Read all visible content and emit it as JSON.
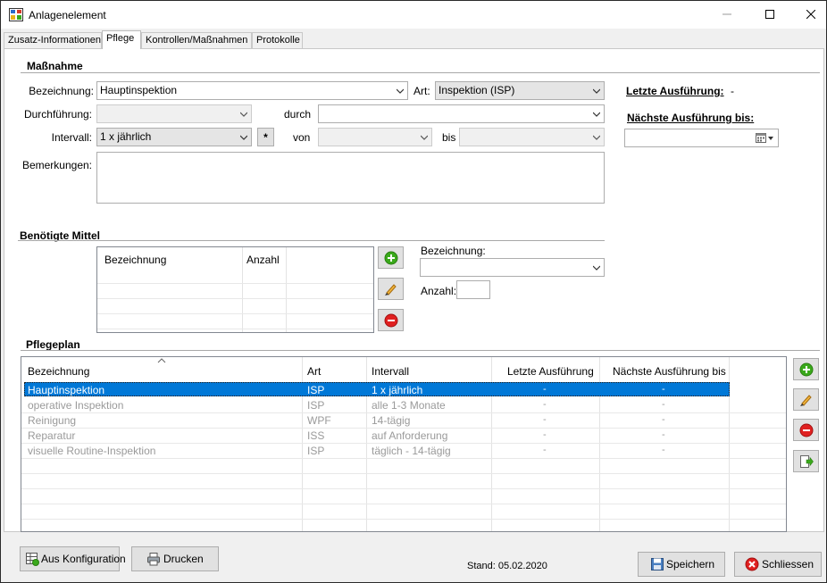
{
  "window": {
    "title": "Anlagenelement"
  },
  "tabs": [
    {
      "label": "Zusatz-Informationen",
      "active": false
    },
    {
      "label": "Pflege",
      "active": true
    },
    {
      "label": "Kontrollen/Maßnahmen",
      "active": false
    },
    {
      "label": "Protokolle",
      "active": false
    }
  ],
  "massnahme": {
    "section_title": "Maßnahme",
    "bezeichnung_label": "Bezeichnung:",
    "bezeichnung_value": "Hauptinspektion",
    "art_label": "Art:",
    "art_value": "Inspektion (ISP)",
    "durchfuehrung_label": "Durchführung:",
    "durchfuehrung_value": "",
    "durch_label": "durch",
    "durch_value": "",
    "intervall_label": "Intervall:",
    "intervall_value": "1 x jährlich",
    "star_button": "*",
    "von_label": "von",
    "von_value": "",
    "bis_label": "bis",
    "bis_value": "",
    "bemerkungen_label": "Bemerkungen:",
    "bemerkungen_value": ""
  },
  "ausfuehrung": {
    "letzte_label": "Letzte Ausführung:",
    "letzte_value": "-",
    "naechste_label": "Nächste Ausführung bis:",
    "naechste_value": ""
  },
  "mittel": {
    "section_title": "Benötigte Mittel",
    "columns": [
      "Bezeichnung",
      "Anzahl"
    ],
    "rows": [],
    "bezeichnung_label": "Bezeichnung:",
    "bezeichnung_value": "",
    "anzahl_label": "Anzahl:",
    "anzahl_value": ""
  },
  "pflegeplan": {
    "section_title": "Pflegeplan",
    "sort_indicator": "^",
    "columns": [
      "Bezeichnung",
      "Art",
      "Intervall",
      "Letzte Ausführung",
      "Nächste Ausführung bis"
    ],
    "rows": [
      {
        "bezeichnung": "Hauptinspektion",
        "art": "ISP",
        "intervall": "1 x jährlich",
        "letzte": "-",
        "naechste": "-",
        "selected": true
      },
      {
        "bezeichnung": "operative Inspektion",
        "art": "ISP",
        "intervall": "alle 1-3 Monate",
        "letzte": "-",
        "naechste": "-",
        "selected": false
      },
      {
        "bezeichnung": "Reinigung",
        "art": "WPF",
        "intervall": "14-tägig",
        "letzte": "-",
        "naechste": "-",
        "selected": false
      },
      {
        "bezeichnung": "Reparatur",
        "art": "ISS",
        "intervall": "auf Anforderung",
        "letzte": "-",
        "naechste": "-",
        "selected": false
      },
      {
        "bezeichnung": "visuelle Routine-Inspektion",
        "art": "ISP",
        "intervall": "täglich - 14-tägig",
        "letzte": "-",
        "naechste": "-",
        "selected": false
      }
    ]
  },
  "footer": {
    "aus_konfiguration": "Aus Konfiguration",
    "drucken": "Drucken",
    "stand": "Stand: 05.02.2020",
    "speichern": "Speichern",
    "schliessen": "Schliessen"
  },
  "colors": {
    "selection": "#0078d7",
    "add_green": "#3aa91b",
    "remove_red": "#e02020"
  }
}
